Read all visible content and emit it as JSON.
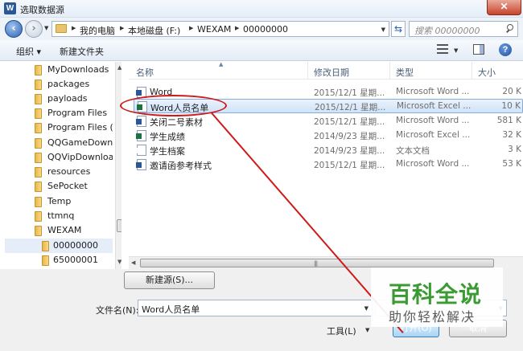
{
  "window": {
    "app_icon_letter": "W",
    "title": "选取数据源",
    "close_label": "✕"
  },
  "address_bar": {
    "breadcrumbs": [
      "我的电脑",
      "本地磁盘 (F:)",
      "WEXAM",
      "00000000"
    ],
    "search_placeholder": "搜索 00000000"
  },
  "toolbar": {
    "organize": "组织 ▾",
    "new_folder": "新建文件夹",
    "help": "?"
  },
  "tree": {
    "items": [
      {
        "label": "MyDownloads"
      },
      {
        "label": "packages"
      },
      {
        "label": "payloads"
      },
      {
        "label": "Program Files"
      },
      {
        "label": "Program Files (x"
      },
      {
        "label": "QQGameDownl"
      },
      {
        "label": "QQVipDownloa"
      },
      {
        "label": "resources"
      },
      {
        "label": "SePocket"
      },
      {
        "label": "Temp"
      },
      {
        "label": "ttmnq"
      },
      {
        "label": "WEXAM"
      },
      {
        "label": "00000000",
        "selected": true
      },
      {
        "label": "65000001"
      }
    ]
  },
  "file_list": {
    "columns": {
      "name": "名称",
      "date": "修改日期",
      "type": "类型",
      "size": "大小"
    },
    "rows": [
      {
        "name": "Word",
        "date": "2015/12/1 星期...",
        "type": "Microsoft Word ...",
        "size": "20 K",
        "icon_color": "#2b5797"
      },
      {
        "name": "Word人员名单",
        "date": "2015/12/1 星期...",
        "type": "Microsoft Excel ...",
        "size": "10 K",
        "icon_color": "#1e7145",
        "selected": true
      },
      {
        "name": "关闭二号素材",
        "date": "2015/12/1 星期...",
        "type": "Microsoft Word ...",
        "size": "581 K",
        "icon_color": "#2b5797"
      },
      {
        "name": "学生成绩",
        "date": "2014/9/23 星期...",
        "type": "Microsoft Excel ...",
        "size": "32 K",
        "icon_color": "#1e7145"
      },
      {
        "name": "学生档案",
        "date": "2014/9/23 星期...",
        "type": "文本文档",
        "size": "3 K",
        "icon_color": "#ffffff"
      },
      {
        "name": "邀请函参考样式",
        "date": "2015/12/1 星期...",
        "type": "Microsoft Word ...",
        "size": "53 K",
        "icon_color": "#2b5797"
      }
    ]
  },
  "bottom": {
    "new_source_button": "新建源(S)...",
    "filename_label": "文件名(N):",
    "filename_value": "Word人员名单",
    "tools_label": "工具(L)",
    "open_button": "打开(O)",
    "cancel_button": "取消"
  },
  "watermark": {
    "main": "百科全说",
    "sub": "助你轻松解决"
  },
  "colors": {
    "annotation": "#d01818",
    "watermark_green": "#3a9b32"
  }
}
